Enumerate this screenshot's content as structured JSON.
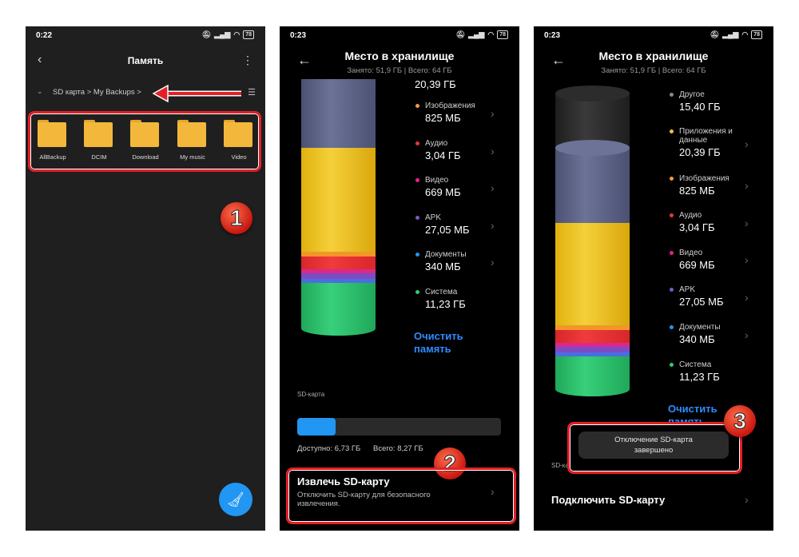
{
  "panel1": {
    "time": "0:22",
    "battery": "78",
    "title": "Память",
    "breadcrumb": "SD карта > My Backups >",
    "folders": [
      "AllBackup",
      "DCIM",
      "Download",
      "My music",
      "Video"
    ],
    "badge": "1"
  },
  "panel2": {
    "time": "0:23",
    "battery": "78",
    "title": "Место в хранилище",
    "subtitle": "Занято: 51,9 ГБ | Всего: 64 ГБ",
    "legend": [
      {
        "name": "",
        "value": "20,39 ГБ",
        "color": "#f1c232"
      },
      {
        "name": "Изображения",
        "value": "825 МБ",
        "color": "#f39c3c"
      },
      {
        "name": "Аудио",
        "value": "3,04 ГБ",
        "color": "#e53935"
      },
      {
        "name": "Видео",
        "value": "669 МБ",
        "color": "#e91e8c"
      },
      {
        "name": "APK",
        "value": "27,05 МБ",
        "color": "#7e57c2"
      },
      {
        "name": "Документы",
        "value": "340 МБ",
        "color": "#2196f3"
      },
      {
        "name": "Система",
        "value": "11,23 ГБ",
        "color": "#2ecc71"
      }
    ],
    "clear_label_1": "Очистить",
    "clear_label_2": "память",
    "sd_label": "SD-карта",
    "sd_used_fraction": 0.19,
    "available": "Доступно: 6,73 ГБ",
    "total": "Всего: 8,27 ГБ",
    "eject_title": "Извлечь SD-карту",
    "eject_desc_1": "Отключить SD-карту для безопасного",
    "eject_desc_2": "извлечения.",
    "badge": "2"
  },
  "panel3": {
    "time": "0:23",
    "battery": "78",
    "title": "Место в хранилище",
    "subtitle": "Занято: 51,9 ГБ | Всего: 64 ГБ",
    "legend": [
      {
        "name": "Другое",
        "value": "15,40 ГБ",
        "color": "#888888"
      },
      {
        "name": "Приложения и данные",
        "value": "20,39 ГБ",
        "color": "#f1c232"
      },
      {
        "name": "Изображения",
        "value": "825 МБ",
        "color": "#f39c3c"
      },
      {
        "name": "Аудио",
        "value": "3,04 ГБ",
        "color": "#e53935"
      },
      {
        "name": "Видео",
        "value": "669 МБ",
        "color": "#e91e8c"
      },
      {
        "name": "APK",
        "value": "27,05 МБ",
        "color": "#7e57c2"
      },
      {
        "name": "Документы",
        "value": "340 МБ",
        "color": "#2196f3"
      },
      {
        "name": "Система",
        "value": "11,23 ГБ",
        "color": "#2ecc71"
      }
    ],
    "clear_label": "Очистить",
    "clear_label_hidden": "память",
    "toast_1": "Отключение SD-карта",
    "toast_2": "завершено",
    "sd_label_partial": "SD-ка",
    "connect": "Подключить SD-карту",
    "badge": "3"
  }
}
